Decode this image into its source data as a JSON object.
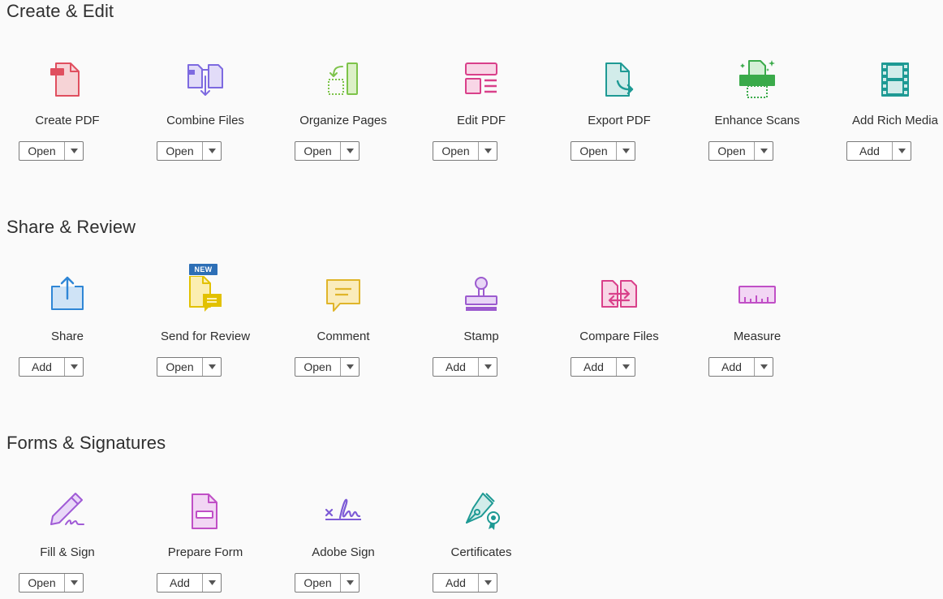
{
  "sections": [
    {
      "title": "Create & Edit",
      "tools": [
        {
          "label": "Create PDF",
          "button": "Open",
          "icon": "create-pdf-icon"
        },
        {
          "label": "Combine Files",
          "button": "Open",
          "icon": "combine-files-icon"
        },
        {
          "label": "Organize Pages",
          "button": "Open",
          "icon": "organize-pages-icon"
        },
        {
          "label": "Edit PDF",
          "button": "Open",
          "icon": "edit-pdf-icon"
        },
        {
          "label": "Export PDF",
          "button": "Open",
          "icon": "export-pdf-icon"
        },
        {
          "label": "Enhance Scans",
          "button": "Open",
          "icon": "enhance-scans-icon"
        },
        {
          "label": "Add Rich Media",
          "button": "Add",
          "icon": "rich-media-icon"
        }
      ]
    },
    {
      "title": "Share & Review",
      "tools": [
        {
          "label": "Share",
          "button": "Add",
          "icon": "share-icon"
        },
        {
          "label": "Send for Review",
          "button": "Open",
          "icon": "send-for-review-icon",
          "badge": "NEW"
        },
        {
          "label": "Comment",
          "button": "Open",
          "icon": "comment-icon"
        },
        {
          "label": "Stamp",
          "button": "Add",
          "icon": "stamp-icon"
        },
        {
          "label": "Compare Files",
          "button": "Add",
          "icon": "compare-files-icon"
        },
        {
          "label": "Measure",
          "button": "Add",
          "icon": "measure-icon"
        }
      ]
    },
    {
      "title": "Forms & Signatures",
      "tools": [
        {
          "label": "Fill & Sign",
          "button": "Open",
          "icon": "fill-sign-icon"
        },
        {
          "label": "Prepare Form",
          "button": "Add",
          "icon": "prepare-form-icon"
        },
        {
          "label": "Adobe Sign",
          "button": "Open",
          "icon": "adobe-sign-icon"
        },
        {
          "label": "Certificates",
          "button": "Add",
          "icon": "certificates-icon"
        }
      ]
    }
  ],
  "colors": {
    "create_pdf": "#e04f5f",
    "combine_files": "#7d6ae0",
    "organize_pages": "#7dc34a",
    "edit_pdf": "#d9408a",
    "export_pdf": "#1e9a94",
    "enhance_scans": "#3aaa4a",
    "rich_media": "#1e9a94",
    "share": "#2f86d6",
    "send_for_review": "#e2c100",
    "comment": "#e0b52a",
    "stamp": "#9c5bcf",
    "compare_files": "#d9408a",
    "measure": "#c04fc6",
    "fill_sign": "#a05bd6",
    "prepare_form": "#c04fc6",
    "adobe_sign": "#7d5bd6",
    "certificates": "#1e9a94",
    "new_badge": "#2d6fb6"
  }
}
